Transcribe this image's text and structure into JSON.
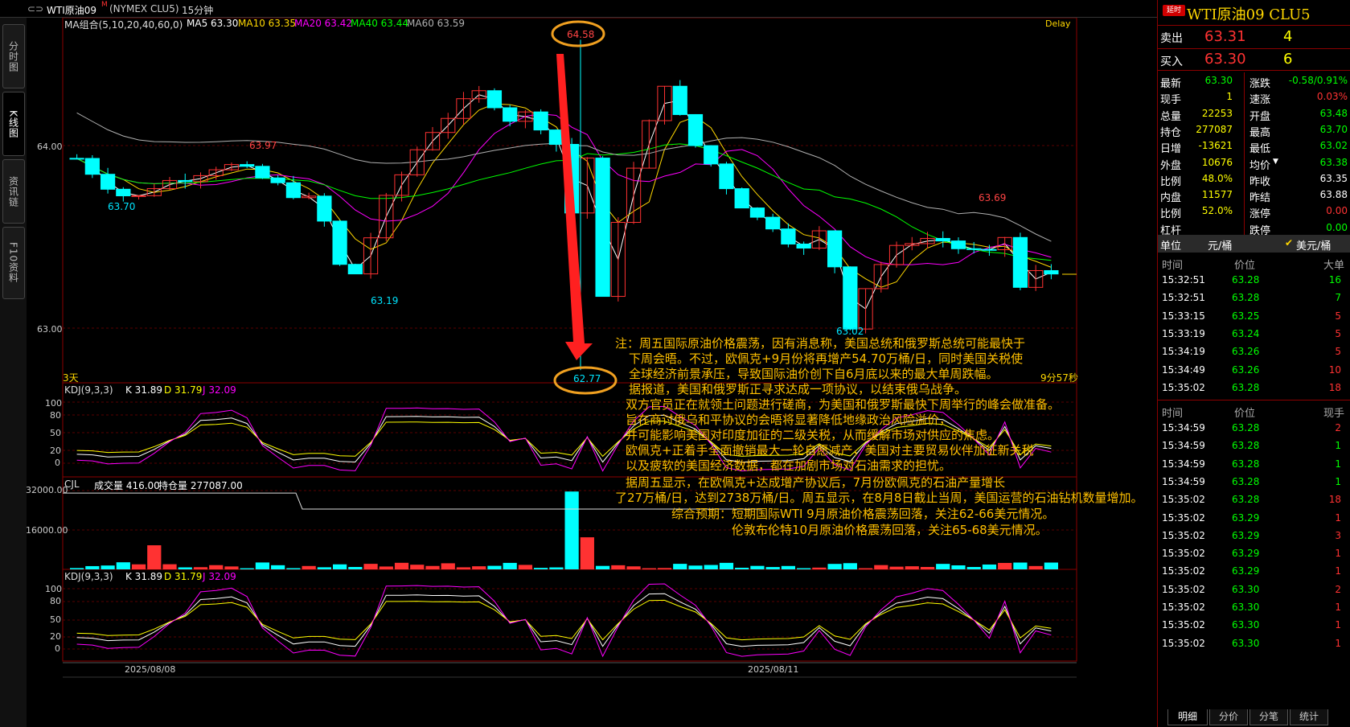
{
  "topbar": {
    "menu_icon": "menu-icon",
    "symbol": "WTI原油09",
    "symbol_suffix": "M",
    "exchange": "(NYMEX CLU5)",
    "period": "15分钟"
  },
  "left_tabs": [
    "分时图",
    "K线图",
    "资讯链",
    "F10资料"
  ],
  "price_panel": {
    "ma_label": "MA组合(5,10,20,40,60,0)",
    "ma": [
      {
        "name": "MA5",
        "value": "63.30",
        "color": "#ffffff"
      },
      {
        "name": "MA10",
        "value": "63.35",
        "color": "#ffd700"
      },
      {
        "name": "MA20",
        "value": "63.42",
        "color": "#ff00ff"
      },
      {
        "name": "MA40",
        "value": "63.44",
        "color": "#00ff00"
      },
      {
        "name": "MA60",
        "value": "63.59",
        "color": "#b0b0b0"
      }
    ],
    "delay": "Delay",
    "y_ticks": [
      "64.00",
      "63.00"
    ],
    "left_bottom": "3天",
    "right_bottom": "9分57秒",
    "annotations": [
      "63.97",
      "63.70",
      "63.19",
      "64.58",
      "62.77",
      "63.02",
      "63.69"
    ]
  },
  "kdj": {
    "title": "KDJ(9,3,3)",
    "k": "K 31.89",
    "d": "D 31.79",
    "j": "J 32.09",
    "ticks": [
      "100",
      "80",
      "50",
      "20",
      "0"
    ]
  },
  "volume": {
    "title": "CJL",
    "vol": "成交量 416.00",
    "oi": "持仓量 277087.00",
    "ticks": [
      "32000.00",
      "16000.00"
    ]
  },
  "kdj2": {
    "title": "KDJ(9,3,3)",
    "k": "K 31.89",
    "d": "D 31.79",
    "j": "J 32.09",
    "ticks": [
      "100",
      "80",
      "50",
      "20",
      "0"
    ]
  },
  "x_dates": [
    "2025/08/08",
    "2025/08/11"
  ],
  "note_lines": [
    "注：周五国际原油价格震荡，因有消息称，美国总统和俄罗斯总统可能最快于",
    "下周会晤。不过，欧佩克+9月份将再增产54.70万桶/日，同时美国关税使",
    "全球经济前景承压，导致国际油价创下自6月底以来的最大单周跌幅。",
    "据报道，美国和俄罗斯正寻求达成一项协议，以结束俄乌战争。",
    "双方官员正在就领土问题进行磋商，为美国和俄罗斯最快下周举行的峰会做准备。",
    "旨在商讨俄乌和平协议的会晤将显著降低地缘政治风险溢价，",
    "并可能影响美国对印度加征的二级关税，从而缓解市场对供应的焦虑。",
    "欧佩克+正着手全面撤销最大一轮自愿减产，美国对主要贸易伙伴加征新关税",
    "以及疲软的美国经济数据，都在加剧市场对石油需求的担忧。",
    "据周五显示，在欧佩克+达成增产协议后，7月份欧佩克的石油产量增长",
    "了27万桶/日，达到2738万桶/日。周五显示，在8月8日截止当周，美国运营的石油钻机数量增加。",
    "综合预期：短期国际WTI 9月原油价格震荡回落，关注62-66美元情况。",
    "伦敦布伦特10月原油价格震荡回落，关注65-68美元情况。"
  ],
  "quote": {
    "badge": "延时",
    "title": "WTI原油09  CLU5",
    "sell_label": "卖出",
    "sell_price": "63.31",
    "sell_qty": "4",
    "buy_label": "买入",
    "buy_price": "63.30",
    "buy_qty": "6",
    "rows": [
      {
        "l1": "最新",
        "v1": "63.30",
        "c1": "#00ff00",
        "l2": "涨跌",
        "v2": "-0.58/0.91%",
        "c2": "#00ff00"
      },
      {
        "l1": "现手",
        "v1": "1",
        "c1": "#ffff00",
        "l2": "速涨",
        "v2": "0.03%",
        "c2": "#ff3333"
      },
      {
        "l1": "总量",
        "v1": "22253",
        "c1": "#ffff00",
        "l2": "开盘",
        "v2": "63.48",
        "c2": "#00ff00"
      },
      {
        "l1": "持仓",
        "v1": "277087",
        "c1": "#ffff00",
        "l2": "最高",
        "v2": "63.70",
        "c2": "#00ff00"
      },
      {
        "l1": "日增",
        "v1": "-13621",
        "c1": "#ffff00",
        "l2": "最低",
        "v2": "63.02",
        "c2": "#00ff00"
      },
      {
        "l1": "外盘",
        "v1": "10676",
        "c1": "#ffff00",
        "l2": "均价",
        "v2": "63.38",
        "c2": "#00ff00"
      },
      {
        "l1": "比例",
        "v1": "48.0%",
        "c1": "#ffff00",
        "l2": "昨收",
        "v2": "63.35",
        "c2": "#ffffff"
      },
      {
        "l1": "内盘",
        "v1": "11577",
        "c1": "#ffff00",
        "l2": "昨结",
        "v2": "63.88",
        "c2": "#ffffff"
      },
      {
        "l1": "比例",
        "v1": "52.0%",
        "c1": "#ffff00",
        "l2": "涨停",
        "v2": "0.00",
        "c2": "#ff3333"
      },
      {
        "l1": "杠杆",
        "v1": "",
        "c1": "#ffff00",
        "l2": "跌停",
        "v2": "0.00",
        "c2": "#00ff00"
      }
    ],
    "unit_label": "单位",
    "unit_opt1": "元/桶",
    "unit_opt2": "美元/桶",
    "ticks1_header": [
      "时间",
      "价位",
      "大单"
    ],
    "ticks1": [
      [
        "15:32:51",
        "63.28",
        "16"
      ],
      [
        "15:32:51",
        "63.28",
        "7"
      ],
      [
        "15:33:15",
        "63.25",
        "5"
      ],
      [
        "15:33:19",
        "63.24",
        "5"
      ],
      [
        "15:34:19",
        "63.26",
        "5"
      ],
      [
        "15:34:49",
        "63.26",
        "10"
      ],
      [
        "15:35:02",
        "63.28",
        "18"
      ]
    ],
    "ticks2_header": [
      "时间",
      "价位",
      "现手"
    ],
    "ticks2": [
      [
        "15:34:59",
        "63.28",
        "2"
      ],
      [
        "15:34:59",
        "63.28",
        "1"
      ],
      [
        "15:34:59",
        "63.28",
        "1"
      ],
      [
        "15:34:59",
        "63.28",
        "1"
      ],
      [
        "15:35:02",
        "63.28",
        "18"
      ],
      [
        "15:35:02",
        "63.29",
        "1"
      ],
      [
        "15:35:02",
        "63.29",
        "3"
      ],
      [
        "15:35:02",
        "63.29",
        "1"
      ],
      [
        "15:35:02",
        "63.29",
        "1"
      ],
      [
        "15:35:02",
        "63.30",
        "2"
      ],
      [
        "15:35:02",
        "63.30",
        "1"
      ],
      [
        "15:35:02",
        "63.30",
        "1"
      ],
      [
        "15:35:02",
        "63.30",
        "1"
      ]
    ],
    "bottom_tabs": [
      "明细",
      "分价",
      "分笔",
      "统计"
    ]
  },
  "colors": {
    "up": "#ff3232",
    "down": "#00ffff",
    "grid": "#8b0000",
    "annot_high": "#ff4444",
    "annot_low": "#00e5ff",
    "oval": "#f0a020",
    "arrow": "#ff2020"
  }
}
